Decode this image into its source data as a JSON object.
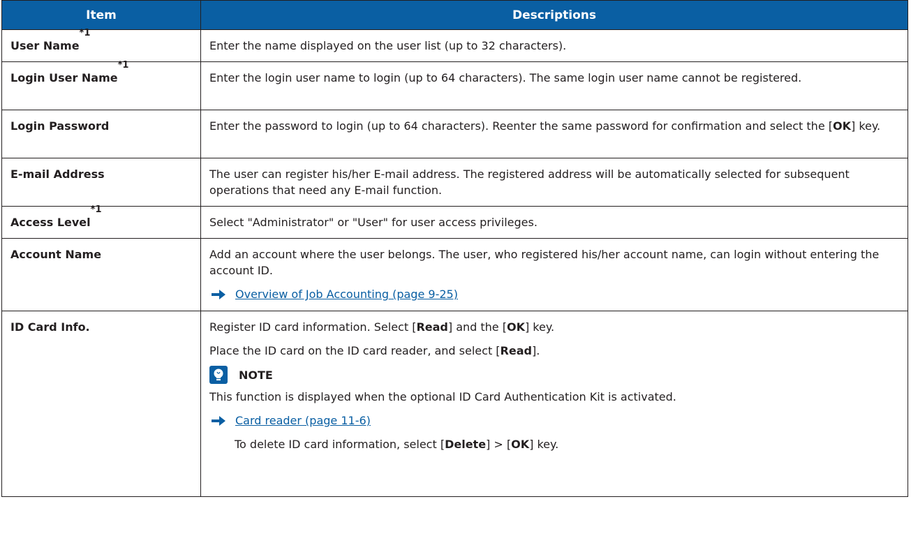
{
  "header": {
    "item": "Item",
    "descriptions": "Descriptions"
  },
  "rows": {
    "user_name": {
      "item": "User Name",
      "sup": "*1",
      "desc": "Enter the name displayed on the user list (up to 32 characters)."
    },
    "login_user_name": {
      "item": "Login User Name",
      "sup": "*1",
      "desc": "Enter the login user name to login (up to 64 characters). The same login user name cannot be registered."
    },
    "login_password": {
      "item": "Login Password",
      "desc_a": "Enter the password to login (up to 64 characters). Reenter the same password for confirmation and select the [",
      "desc_ok": "OK",
      "desc_b": "] key."
    },
    "email": {
      "item": "E-mail Address",
      "desc": "The user can register his/her E-mail address. The registered address will be automatically selected for subsequent operations that need any E-mail function."
    },
    "access_level": {
      "item": "Access Level",
      "sup": "*1",
      "desc": "Select \"Administrator\" or \"User\" for user access privileges."
    },
    "account_name": {
      "item": "Account Name",
      "desc": "Add an account where the user belongs. The user, who registered his/her account name, can login without entering the account ID.",
      "link": "Overview of Job Accounting (page 9-25)"
    },
    "id_card": {
      "item": "ID Card Info.",
      "p1_a": "Register ID card information. Select [",
      "p1_read": "Read",
      "p1_b": "] and the [",
      "p1_ok": "OK",
      "p1_c": "] key.",
      "p2_a": "Place the ID card on the ID card reader, and select [",
      "p2_read": "Read",
      "p2_b": "].",
      "note_title": "NOTE",
      "note_text": "This function is displayed when the optional ID Card Authentication Kit is activated.",
      "link": "Card reader (page 11-6)",
      "p3_a": "To delete ID card information, select [",
      "p3_delete": "Delete",
      "p3_b": "] > [",
      "p3_ok": "OK",
      "p3_c": "] key."
    }
  },
  "colors": {
    "header_bg": "#0a5fa3",
    "link": "#0a5fa3",
    "text": "#231f20"
  },
  "icons": {
    "arrow": "right-arrow-icon",
    "note": "note-lightbulb-icon"
  }
}
